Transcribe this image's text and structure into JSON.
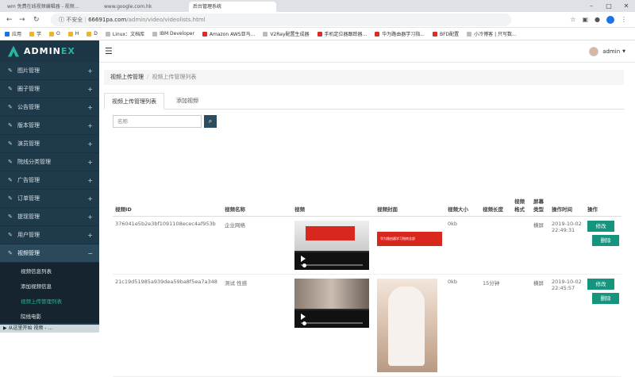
{
  "browser": {
    "tabs": [
      "wm 免费在线视频编辑器 - 视频...",
      "www.google.com.hk",
      "后台管理系统"
    ],
    "url_security": "不安全",
    "url_host": "66691pa.com",
    "url_path": "/admin/video/videolists.html",
    "bookmarks": [
      {
        "label": "应用",
        "color": "#1a73e8"
      },
      {
        "label": "学",
        "color": "#f0b429"
      },
      {
        "label": "O",
        "color": "#f0b429"
      },
      {
        "label": "H",
        "color": "#f0b429"
      },
      {
        "label": "D",
        "color": "#f0b429"
      },
      {
        "label": "Linux：文档库",
        "color": "#bbbbbb"
      },
      {
        "label": "IBM Developer",
        "color": "#bbbbbb"
      },
      {
        "label": "Amazon AWS亚马...",
        "color": "#d93025"
      },
      {
        "label": "V2Ray配置生成器",
        "color": "#bbbbbb"
      },
      {
        "label": "手机定位器跟踪器...",
        "color": "#d93025"
      },
      {
        "label": "华为路由器学习指...",
        "color": "#d93025"
      },
      {
        "label": "BFD配置",
        "color": "#d93025"
      },
      {
        "label": "小冷博客 | 只写数...",
        "color": "#bbbbbb"
      }
    ]
  },
  "brand": {
    "prefix": "ADMIN",
    "suffix": "EX"
  },
  "sidebar": {
    "items": [
      {
        "label": "图片管理"
      },
      {
        "label": "圈子管理"
      },
      {
        "label": "公告管理"
      },
      {
        "label": "版本管理"
      },
      {
        "label": "演员管理"
      },
      {
        "label": "院线分类管理"
      },
      {
        "label": "广告管理"
      },
      {
        "label": "订单管理"
      },
      {
        "label": "提现管理"
      },
      {
        "label": "用户管理"
      }
    ],
    "open_item": {
      "label": "视频管理",
      "toggle": "−"
    },
    "sub_items": [
      {
        "label": "视频信息列表"
      },
      {
        "label": "添加视频信息"
      },
      {
        "label": "视频上传管理列表"
      },
      {
        "label": "院线电影"
      }
    ],
    "plus": "+"
  },
  "header": {
    "user": "admin"
  },
  "breadcrumb": {
    "root": "视频上传管理",
    "current": "视频上传管理列表"
  },
  "tabs": [
    {
      "label": "视频上传管理列表"
    },
    {
      "label": "添加视频"
    }
  ],
  "search": {
    "placeholder": "名称"
  },
  "table": {
    "headers": [
      "视频ID",
      "视频名称",
      "视频",
      "视频封面",
      "视频大小",
      "视频长度",
      "视频格式",
      "屏幕类型",
      "操作时间",
      "操作"
    ],
    "rows": [
      {
        "id": "376041e5b2e3bf1091108ecec4af953b",
        "name": "企业网络",
        "size": "0kb",
        "length": "",
        "format": "",
        "screen": "横屏",
        "time": "2019-10-02 22:49:31",
        "cover_text": "华为路由器学习指南全部"
      },
      {
        "id": "21c19d51985a939dea59ba8f5ea7a348",
        "name": "测试 性感",
        "size": "0kb",
        "length": "15分钟",
        "format": "",
        "screen": "横屏",
        "time": "2019-10-02 22:45:57",
        "cover_text": ""
      }
    ],
    "edit_label": "修改",
    "delete_label": "删除"
  },
  "taskbar": {
    "text": "▶ 从这里开始 视频 - ..."
  }
}
